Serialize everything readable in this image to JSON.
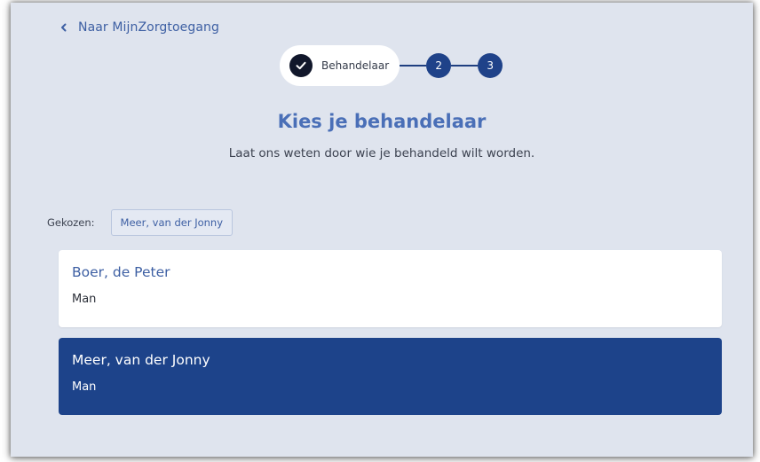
{
  "nav": {
    "back_label": "Naar MijnZorgtoegang"
  },
  "stepper": {
    "steps": [
      {
        "label": "Behandelaar",
        "state": "completed"
      },
      {
        "number": "2",
        "state": "upcoming"
      },
      {
        "number": "3",
        "state": "upcoming"
      }
    ]
  },
  "header": {
    "title": "Kies je behandelaar",
    "subtitle": "Laat ons weten door wie je behandeld wilt worden."
  },
  "selection": {
    "label": "Gekozen:",
    "value": "Meer, van der Jonny"
  },
  "practitioners": [
    {
      "name": "Boer, de Peter",
      "gender": "Man",
      "selected": false
    },
    {
      "name": "Meer, van der Jonny",
      "gender": "Man",
      "selected": true
    }
  ],
  "colors": {
    "background": "#dfe4ee",
    "accent": "#1d438a",
    "link": "#3d5fa3",
    "title": "#4a6fb7",
    "check_circle": "#11172b"
  },
  "icons": {
    "back": "chevron-left-icon",
    "check": "check-icon"
  }
}
